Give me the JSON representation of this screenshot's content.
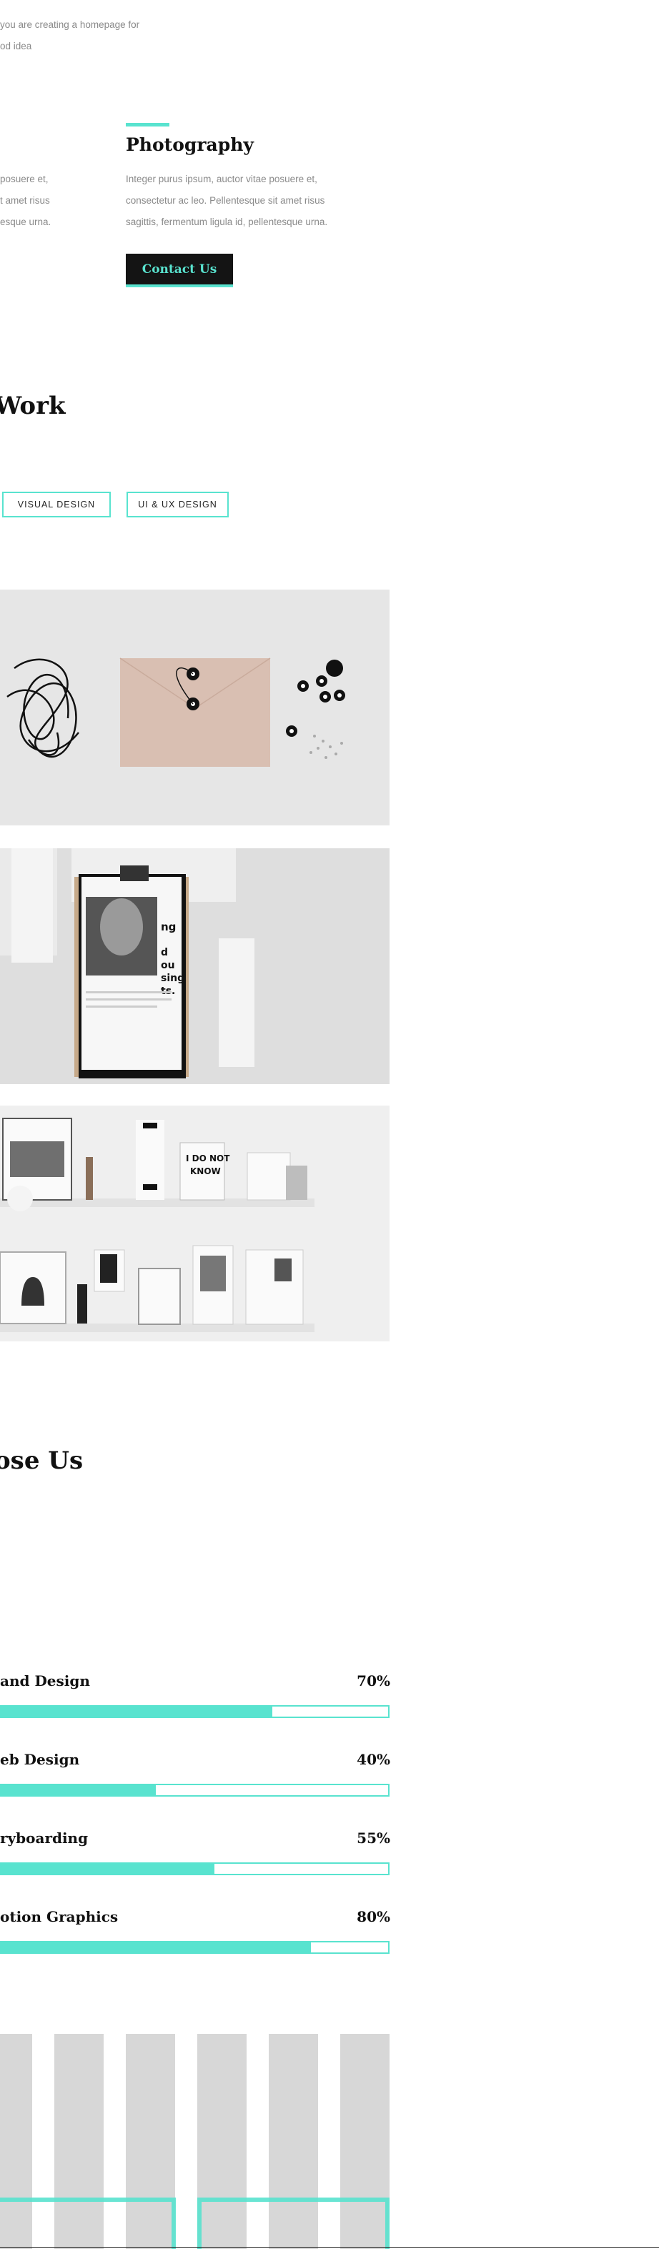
{
  "intro": {
    "line1": "you are creating a homepage for",
    "line2": "od idea"
  },
  "services": {
    "left_lines": [
      "posuere et,",
      "t amet risus",
      "esque urna."
    ],
    "photography": {
      "title": "Photography",
      "lines": [
        "Integer purus ipsum, auctor vitae posuere et,",
        "consectetur ac leo. Pellentesque sit amet risus",
        "sagittis, fermentum ligula id, pellentesque urna."
      ],
      "button": "Contact Us"
    }
  },
  "work": {
    "title": "Work",
    "filters": [
      "VISUAL DESIGN",
      "UI & UX DESIGN"
    ]
  },
  "why": {
    "title": "ose Us"
  },
  "skills": [
    {
      "label": "and Design",
      "pct": "70%",
      "value": 0.7
    },
    {
      "label": "eb Design",
      "pct": "40%",
      "value": 0.4
    },
    {
      "label": "ryboarding",
      "pct": "55%",
      "value": 0.55
    },
    {
      "label": "otion Graphics",
      "pct": "80%",
      "value": 0.8
    }
  ],
  "colors": {
    "accent": "#59e3cf",
    "dark": "#141414",
    "placeholder": "#d7d7d7"
  }
}
